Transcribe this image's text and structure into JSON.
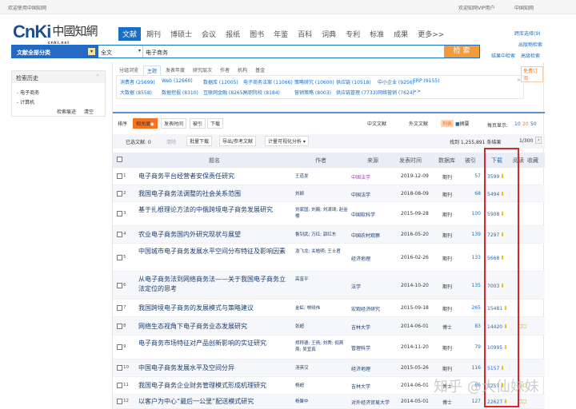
{
  "topbar": {
    "welcome": "欢迎使用中国知网",
    "vip": "欢迎知网VIP用户",
    "cnki": "中国知网"
  },
  "logo": {
    "text": "CNKI",
    "cn": "中国知网",
    "sub": "cnki.net"
  },
  "nav": [
    "文献",
    "期刊",
    "博硕士",
    "会议",
    "报纸",
    "图书",
    "年鉴",
    "百科",
    "词典",
    "专利",
    "标准",
    "成果",
    "更多>>"
  ],
  "search": {
    "category": "文献全部分类",
    "field": "全文",
    "query": "电子商务",
    "button": "检 索"
  },
  "right_links": {
    "cross": "跨库选择(9)",
    "publication": "出版物检索",
    "in_result": "结果中检索",
    "advanced": "高级检索"
  },
  "history": {
    "title": "检索历史",
    "items": [
      "电子商务",
      "计算机"
    ],
    "all": "检索痕迹",
    "clear": "清空"
  },
  "filter_tabs": [
    "分组浏览",
    "主题",
    "发表年度",
    "研究层次",
    "作者",
    "机构",
    "基金"
  ],
  "free_sub": "免费订阅",
  "terms": [
    [
      "消费者 (25699)",
      "Web (12660)",
      "数据库 (12005)",
      "电子商务法案 (11066)",
      "策略研究 (10600)",
      "供应链 (10518)",
      "中小企业 (9256)",
      "ERP (9155)"
    ],
    [
      "大数据 (8558)",
      "数据挖掘 (8310)",
      "互联网金融 (8265)",
      "高职院校 (8184)",
      "营销策略 (8003)",
      "供应链管理 (7733)",
      "网络营销 (7624)",
      ">>"
    ]
  ],
  "sort": {
    "label": "排序",
    "options": [
      "相关度",
      "发表时间",
      "被引",
      "下载"
    ],
    "chinese": "中文文献",
    "foreign": "外文文献",
    "list": "列表",
    "abstract": "摘要",
    "per_page_label": "每页显示:",
    "per_page": [
      "10",
      "20",
      "50"
    ]
  },
  "selection": {
    "selected": "已选文献: 0",
    "clear": "清除",
    "batch": "批量下载",
    "export": "导出/参考文献",
    "analysis": "计量可视化分析",
    "found": "找到 1,255,891 条结果",
    "page": "1/300"
  },
  "headers": {
    "title": "题名",
    "author": "作者",
    "source": "来源",
    "date": "发表时间",
    "db": "数据库",
    "cite": "被引",
    "download": "下载",
    "read": "阅读",
    "fav": "收藏"
  },
  "rows": [
    {
      "n": "1",
      "title": "电子商务平台经营者安保责任研究",
      "author": "王道发",
      "source": "中国法学",
      "date": "2019-12-09",
      "db": "期刊",
      "cite": "57",
      "dl": "3599"
    },
    {
      "n": "2",
      "title": "我国电子商务法调整的社会关系范围",
      "author": "刘颖",
      "source": "中国法学",
      "date": "2018-08-09",
      "db": "期刊",
      "cite": "68",
      "dl": "5494"
    },
    {
      "n": "3",
      "title": "基于扎根理论方法的中俄跨境电子商务发展研究",
      "author": "刘家国; 刘巍; 刘潇琦; 赵金楼",
      "source": "中国软科学",
      "date": "2015-09-28",
      "db": "期刊",
      "cite": "100",
      "dl": "5908"
    },
    {
      "n": "4",
      "title": "农业电子商务国内外研究现状与展望",
      "author": "鲁钊武; 万红; 郭红东",
      "source": "中国农村观察",
      "date": "2016-05-20",
      "db": "期刊",
      "cite": "139",
      "dl": "7297"
    },
    {
      "n": "5",
      "title": "中国城市电子商务发展水平空间分布特征及影响因素",
      "author": "浩飞龙; 关皓明; 王士君",
      "source": "经济地理",
      "date": "2016-02-26",
      "db": "期刊",
      "cite": "133",
      "dl": "5668"
    },
    {
      "n": "6",
      "title": "从电子商务法到网络商务法——关于我国电子商务立法定位的思考",
      "author": "高富平",
      "source": "法学",
      "date": "2014-10-20",
      "db": "期刊",
      "cite": "135",
      "dl": "7003"
    },
    {
      "n": "7",
      "title": "我国跨境电子商务的发展模式与策略建议",
      "author": "金虹; 林晓伟",
      "source": "宏观经济研究",
      "date": "2015-09-18",
      "db": "期刊",
      "cite": "265",
      "dl": "15481"
    },
    {
      "n": "8",
      "title": "网络生态视角下电子商务业态发展研究",
      "author": "张超",
      "source": "吉林大学",
      "date": "2014-06-01",
      "db": "博士",
      "cite": "83",
      "dl": "14420"
    },
    {
      "n": "9",
      "title": "电子商务市场特征对产品创新影响的实证研究",
      "author": "郑称德; 王倩; 刘秀; 倪燕燕; 吴宜真",
      "source": "管理科学",
      "date": "2014-11-20",
      "db": "期刊",
      "cite": "79",
      "dl": "10995"
    },
    {
      "n": "10",
      "title": "中国电子商务发展水平及空间分异",
      "author": "汤英汉",
      "source": "经济地理",
      "date": "2015-05-26",
      "db": "期刊",
      "cite": "116",
      "dl": "5157"
    },
    {
      "n": "11",
      "title": "我国电子商务企业财务管理模式形成机理研究",
      "author": "杨超",
      "source": "吉林大学",
      "date": "2014-06-01",
      "db": "博士",
      "cite": "86",
      "dl": "5257"
    },
    {
      "n": "12",
      "title": "以客户为中心“最后一公里”配送模式研究",
      "author": "杨聚中",
      "source": "对外经济贸易大学",
      "date": "2014-05-01",
      "db": "博士",
      "cite": "127",
      "dl": "22627"
    }
  ],
  "watermark": "知乎 @大仙妹妹",
  "colors": {
    "brand": "#1a6fc4",
    "accent": "#f5731f",
    "highlight": "#d9262b"
  }
}
